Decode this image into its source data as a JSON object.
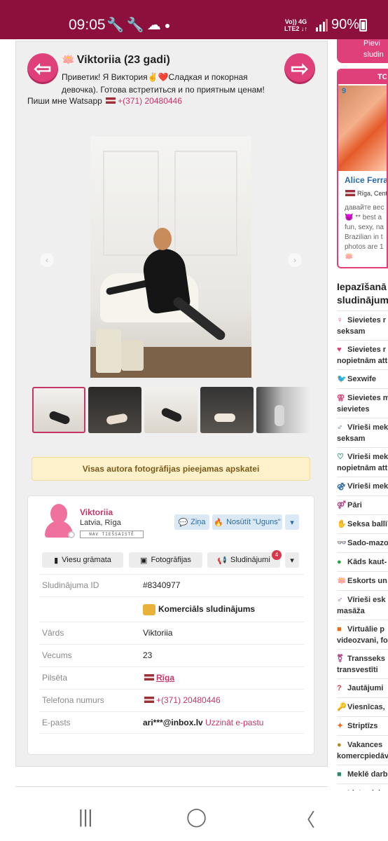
{
  "statusbar": {
    "time": "09:05",
    "icons": "🔧🔧☁",
    "net_top": "Vo)) 4G",
    "net_bottom": "LTE2 ↓↑",
    "battery": "90%"
  },
  "profile": {
    "name_title": "Viktoriia (23 gadi)",
    "intro_line": "Приветик! Я Виктория✌️❤️Сладкая и покорная девочка). Готова встретиться и по приятным ценам!",
    "whatsapp_text": "Пиши мне Watsapp",
    "phone": "+(371) 20480446"
  },
  "gallery": {
    "notice": "Visas autora fotogrāfijas pieejamas apskatei"
  },
  "user": {
    "name": "Viktoriia",
    "location": "Latvia, Rīga",
    "badge": "NAV TIEŠSAISTĒ",
    "message_btn": "Ziņa",
    "fire_btn": "Nosūtīt \"Uguns\"",
    "guestbook_btn": "Viesu grāmata",
    "photos_btn": "Fotogrāfijas",
    "ads_btn": "Sludinājumi",
    "ads_count": "4"
  },
  "details": {
    "ad_id_label": "Sludinājuma ID",
    "ad_id": "#8340977",
    "commercial": "Komerciāls sludinājums",
    "name_label": "Vārds",
    "name": "Viktoriia",
    "age_label": "Vecums",
    "age": "23",
    "city_label": "Pilsēta",
    "city": "Rīga",
    "phone_label": "Telefona numurs",
    "phone": "+(371) 20480446",
    "email_label": "E-pasts",
    "email": "ari***@inbox.lv",
    "email_link": "Uzzināt e-pastu"
  },
  "sidebar": {
    "top_btn_1": "Pievi",
    "top_btn_2": "sludin",
    "top_head": "TO",
    "top_num": "9",
    "top_name": "Alice Ferra",
    "top_loc": "Rīga, Centr",
    "top_desc": [
      "давайте вес",
      "😈 ** best a",
      "fun, sexy, na",
      "Brazilian in t",
      "photos are 1",
      "🪷"
    ],
    "cat_title_1": "Iepazīšanā",
    "cat_title_2": "sludinājum",
    "categories": [
      {
        "icon": "♀",
        "color": "#e0407a",
        "text": "Sievietes r",
        "text2": "seksam"
      },
      {
        "icon": "♥",
        "color": "#e0407a",
        "text": "Sievietes r",
        "text2": "nopietnām att"
      },
      {
        "icon": "🐦",
        "color": "#e0407a",
        "text": "Sexwife",
        "text2": ""
      },
      {
        "icon": "⚢",
        "color": "#e0407a",
        "text": "Sievietes m",
        "text2": "sievietes"
      },
      {
        "icon": "♂",
        "color": "#2a6aa8",
        "text": "Vīrieši mek",
        "text2": "seksam"
      },
      {
        "icon": "♡",
        "color": "#2a8a6a",
        "text": "Vīrieši mek",
        "text2": "nopietnām att"
      },
      {
        "icon": "⚣",
        "color": "#2a6aa8",
        "text": "Vīrieši mek",
        "text2": ""
      },
      {
        "icon": "⚤",
        "color": "#b04a8a",
        "text": "Pāri",
        "text2": ""
      },
      {
        "icon": "✋",
        "color": "#e0b020",
        "text": "Seksa ballī",
        "text2": ""
      },
      {
        "icon": "👓",
        "color": "#555555",
        "text": "Sado-mazo",
        "text2": ""
      },
      {
        "icon": "●",
        "color": "#2aa04a",
        "text": "Kāds kaut-",
        "text2": ""
      },
      {
        "icon": "🪷",
        "color": "#8a43b5",
        "text": "Eskorts un",
        "text2": ""
      },
      {
        "icon": "♂",
        "color": "#8a43b5",
        "text": "Vīrieši esk",
        "text2": "masāža"
      },
      {
        "icon": "■",
        "color": "#e87020",
        "text": "Virtuālie p",
        "text2": "videozvani, fo"
      },
      {
        "icon": "⚧",
        "color": "#b04a8a",
        "text": "Transseks",
        "text2": "transvestīti"
      },
      {
        "icon": "?",
        "color": "#d63a4a",
        "text": "Jautājumi",
        "text2": ""
      },
      {
        "icon": "🔑",
        "color": "#e0b020",
        "text": "Viesnīcas,",
        "text2": ""
      },
      {
        "icon": "✦",
        "color": "#e87020",
        "text": "Striptīzs",
        "text2": ""
      },
      {
        "icon": "●",
        "color": "#b08a20",
        "text": "Vakances",
        "text2": "komercpiedāv"
      },
      {
        "icon": "■",
        "color": "#2a8a6a",
        "text": "Meklē darb",
        "text2": ""
      },
      {
        "icon": "●",
        "color": "#d63a4a",
        "text": "Lietas laba",
        "text2": ""
      }
    ]
  },
  "navbar": {
    "recent": "|||",
    "home": "◯",
    "back": "〈"
  }
}
